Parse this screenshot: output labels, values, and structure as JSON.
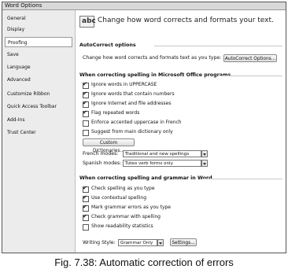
{
  "window": {
    "title": "Word Options"
  },
  "sidebar": {
    "items": [
      {
        "label": "General"
      },
      {
        "label": "Display"
      },
      {
        "label": "Proofing",
        "selected": true
      },
      {
        "label": "Save"
      },
      {
        "label": "Language"
      },
      {
        "label": "Advanced"
      },
      {
        "label": "Customize Ribbon"
      },
      {
        "label": "Quick Access Toolbar"
      },
      {
        "label": "Add-Ins"
      },
      {
        "label": "Trust Center"
      }
    ]
  },
  "header": {
    "icon": "abc-check-icon",
    "icon_text": "abc",
    "title": "Change how word corrects and formats your text."
  },
  "autocorrect": {
    "section_title": "AutoCorrect options",
    "description": "Change how word corrects and formats text as you type:",
    "button": "AutoCorrect Options..."
  },
  "office_spelling": {
    "section_title": "When correcting spelling in Microsoft Office programs",
    "options": [
      {
        "label": "Ignore words in UPPERCASE",
        "checked": true
      },
      {
        "label": "Ignore words that contain numbers",
        "checked": true
      },
      {
        "label": "Ignore Internet and file addresses",
        "checked": true
      },
      {
        "label": "Flag repeated words",
        "checked": true
      },
      {
        "label": "Enforce accented uppercase in French",
        "checked": false
      },
      {
        "label": "Suggest from main dictionary only",
        "checked": false
      }
    ],
    "custom_dictionaries_button": "Custom Dictionaries...",
    "french_modes_label": "French modes:",
    "french_modes_value": "Traditional and new spellings",
    "spanish_modes_label": "Spanish modes:",
    "spanish_modes_value": "Tuteo verb forms only"
  },
  "word_spelling": {
    "section_title": "When correcting spelling and grammar in Word",
    "options": [
      {
        "label": "Check spelling as you type",
        "checked": true
      },
      {
        "label": "Use contextual spelling",
        "checked": true
      },
      {
        "label": "Mark grammar errors as you type",
        "checked": true
      },
      {
        "label": "Check grammar with spelling",
        "checked": true
      },
      {
        "label": "Show readability statistics",
        "checked": false
      }
    ],
    "writing_style_label": "Writing Style:",
    "writing_style_value": "Grammar Only",
    "settings_button": "Settings..."
  },
  "caption": "Fig. 7.38: Automatic correction of errors"
}
